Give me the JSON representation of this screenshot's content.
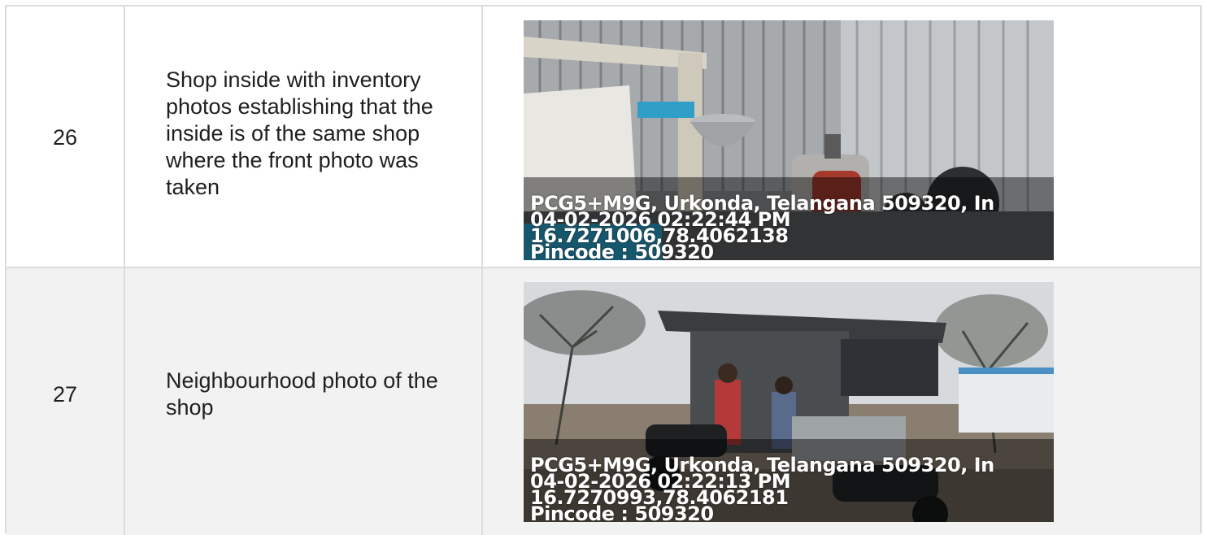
{
  "rows": [
    {
      "number": "26",
      "description": "Shop inside with inventory photos establishing that the inside is of the same shop where the front photo was taken",
      "stamp": {
        "address": "PCG5+M9G, Urkonda, Telangana 509320, In",
        "datetime": "04-02-2026 02:22:44 PM",
        "coordinates": "16.7271006,78.4062138",
        "pincode": "Pincode : 509320"
      }
    },
    {
      "number": "27",
      "description": "Neighbourhood photo of the shop",
      "stamp": {
        "address": "PCG5+M9G, Urkonda, Telangana 509320, In",
        "datetime": "04-02-2026 02:22:13 PM",
        "coordinates": "16.7270993,78.4062181",
        "pincode": "Pincode : 509320"
      }
    }
  ]
}
